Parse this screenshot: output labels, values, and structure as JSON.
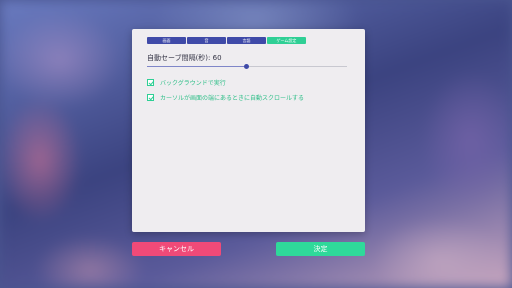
{
  "tabs": [
    {
      "label": "画面",
      "active": false
    },
    {
      "label": "音",
      "active": false
    },
    {
      "label": "言語",
      "active": false
    },
    {
      "label": "ゲーム設定",
      "active": true
    }
  ],
  "autosave": {
    "label": "自動セーブ間隔(秒): 60",
    "slider_fraction": 0.495
  },
  "options": [
    {
      "label": "バックグラウンドで実行",
      "checked": true
    },
    {
      "label": "カーソルが画面の端にあるときに自動スクロールする",
      "checked": true
    }
  ],
  "buttons": {
    "cancel_label": "キャンセル",
    "ok_label": "決定"
  },
  "colors": {
    "tab": "#3f4aa8",
    "tab_active": "#2fcf95",
    "cancel": "#f04a78",
    "ok": "#2fd99a",
    "check": "#2fcf95"
  }
}
